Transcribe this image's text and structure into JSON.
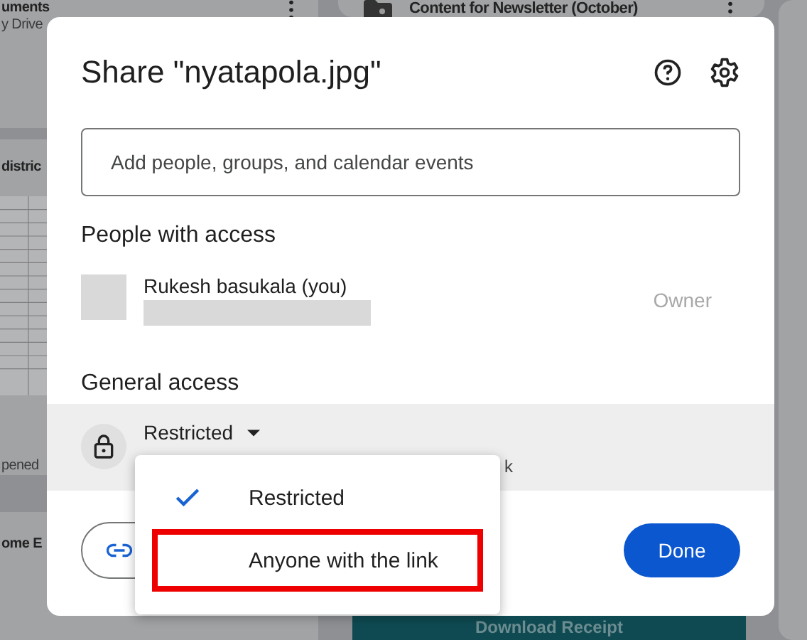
{
  "background": {
    "cards": [
      {
        "title": "uments",
        "subtitle": "y Drive"
      },
      {
        "title": "Content for Newsletter (October)"
      },
      {
        "title": "distric",
        "subtitle": "pened"
      },
      {
        "title": "ome E"
      }
    ],
    "receipt_button": "Download Receipt"
  },
  "dialog": {
    "title": "Share \"nyatapola.jpg\"",
    "search": {
      "placeholder": "Add people, groups, and calendar events"
    },
    "people_heading": "People with access",
    "people": [
      {
        "name": "Rukesh basukala (you)",
        "role": "Owner"
      }
    ],
    "general_heading": "General access",
    "access": {
      "value": "Restricted",
      "description": "k"
    },
    "menu": [
      {
        "label": "Restricted",
        "selected": true,
        "highlighted": false
      },
      {
        "label": "Anyone with the link",
        "selected": false,
        "highlighted": true
      }
    ],
    "done": "Done"
  }
}
